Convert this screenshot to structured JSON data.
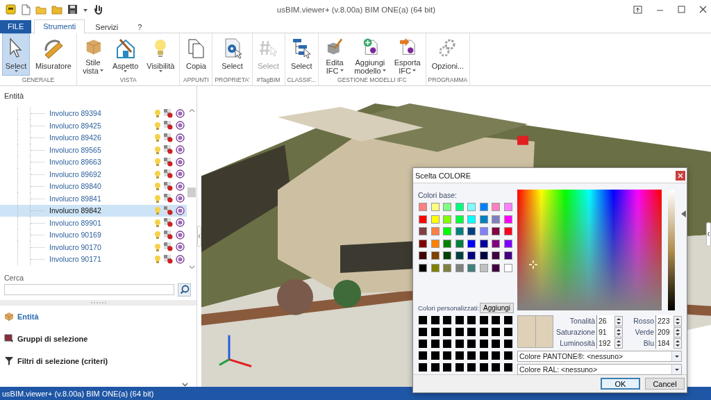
{
  "window": {
    "title": "usBIM.viewer+ (v.8.00a)  BIM ONE(a) (64 bit)"
  },
  "ribbon_tabs": [
    {
      "label": "FILE",
      "kind": "file",
      "selected": false
    },
    {
      "label": "Strumenti",
      "kind": "tab",
      "selected": true
    },
    {
      "label": "Servizi",
      "kind": "tab",
      "selected": false
    },
    {
      "label": "?",
      "kind": "tab",
      "selected": false
    }
  ],
  "ribbon_groups": [
    {
      "label": "GENERALE",
      "buttons": [
        {
          "lines": [
            "Select"
          ],
          "dropdown": true,
          "selected": true,
          "disabled": false
        },
        {
          "lines": [
            "Misuratore"
          ],
          "dropdown": false,
          "selected": false,
          "disabled": false
        }
      ]
    },
    {
      "label": "VISTA",
      "buttons": [
        {
          "lines": [
            "Stile",
            "vista"
          ],
          "dropdown": true,
          "selected": false,
          "disabled": false
        },
        {
          "lines": [
            "Aspetto"
          ],
          "dropdown": true,
          "selected": false,
          "disabled": false
        },
        {
          "lines": [
            "Visibilità"
          ],
          "dropdown": true,
          "selected": false,
          "disabled": false
        }
      ]
    },
    {
      "label": "APPUNTI",
      "buttons": [
        {
          "lines": [
            "Copia"
          ],
          "dropdown": false,
          "selected": false,
          "disabled": false
        }
      ]
    },
    {
      "label": "PROPRIETA'",
      "buttons": [
        {
          "lines": [
            "Select"
          ],
          "dropdown": false,
          "selected": false,
          "disabled": false
        }
      ]
    },
    {
      "label": "#TagBIM",
      "buttons": [
        {
          "lines": [
            "Select"
          ],
          "dropdown": false,
          "selected": false,
          "disabled": true
        }
      ]
    },
    {
      "label": "CLASSIF...",
      "buttons": [
        {
          "lines": [
            "Select"
          ],
          "dropdown": false,
          "selected": false,
          "disabled": false
        }
      ]
    },
    {
      "label": "GESTIONE MODELLI IFC",
      "buttons": [
        {
          "lines": [
            "Edita",
            "IFC"
          ],
          "dropdown": true,
          "selected": false,
          "disabled": false
        },
        {
          "lines": [
            "Aggiungi",
            "modello"
          ],
          "dropdown": true,
          "selected": false,
          "disabled": false
        },
        {
          "lines": [
            "Esporta",
            "IFC"
          ],
          "dropdown": true,
          "selected": false,
          "disabled": false
        }
      ]
    },
    {
      "label": "PROGRAMMA",
      "buttons": [
        {
          "lines": [
            "Opzioni..."
          ],
          "dropdown": false,
          "selected": false,
          "disabled": false
        }
      ]
    }
  ],
  "entities": {
    "header": "Entità",
    "items": [
      {
        "label": "Involucro 89394",
        "selected": false
      },
      {
        "label": "Involucro 89425",
        "selected": false
      },
      {
        "label": "Involucro 89426",
        "selected": false
      },
      {
        "label": "Involucro 89565",
        "selected": false
      },
      {
        "label": "Involucro 89663",
        "selected": false
      },
      {
        "label": "Involucro 89692",
        "selected": false
      },
      {
        "label": "Involucro 89840",
        "selected": false
      },
      {
        "label": "Involucro 89841",
        "selected": false
      },
      {
        "label": "Involucro 89842",
        "selected": true
      },
      {
        "label": "Involucro 89901",
        "selected": false
      },
      {
        "label": "Involucro 90169",
        "selected": false
      },
      {
        "label": "Involucro 90170",
        "selected": false
      },
      {
        "label": "Involucro 90171",
        "selected": false
      }
    ]
  },
  "search_label": "Cerca",
  "nav": [
    {
      "label": "Entità",
      "kind": "entities",
      "selected": true
    },
    {
      "label": "Gruppi di selezione",
      "kind": "groups",
      "selected": false
    },
    {
      "label": "Filtri di selezione (criteri)",
      "kind": "filters",
      "selected": false
    }
  ],
  "color_dialog": {
    "title": "Scelta COLORE",
    "basic_label": "Colori base:",
    "basic_colors": [
      {
        "color": "#ff8080"
      },
      {
        "color": "#ffff80"
      },
      {
        "color": "#80ff80"
      },
      {
        "color": "#00ff80"
      },
      {
        "color": "#80ffff"
      },
      {
        "color": "#0080ff"
      },
      {
        "color": "#ff80c0"
      },
      {
        "color": "#ff80ff"
      },
      {
        "color": "#ff0000"
      },
      {
        "color": "#ffff00"
      },
      {
        "color": "#80ff00"
      },
      {
        "color": "#00ff40"
      },
      {
        "color": "#00ffff"
      },
      {
        "color": "#0080c0"
      },
      {
        "color": "#8080c0"
      },
      {
        "color": "#ff00ff"
      },
      {
        "color": "#804040"
      },
      {
        "color": "#ff8040"
      },
      {
        "color": "#00ff00"
      },
      {
        "color": "#008080"
      },
      {
        "color": "#004080"
      },
      {
        "color": "#8080ff"
      },
      {
        "color": "#800040"
      },
      {
        "color": "#ff0020"
      },
      {
        "color": "#800000"
      },
      {
        "color": "#ff8000"
      },
      {
        "color": "#008000"
      },
      {
        "color": "#008040"
      },
      {
        "color": "#0000ff"
      },
      {
        "color": "#0000a0"
      },
      {
        "color": "#800080"
      },
      {
        "color": "#8000ff"
      },
      {
        "color": "#400000"
      },
      {
        "color": "#804000"
      },
      {
        "color": "#004000"
      },
      {
        "color": "#004040"
      },
      {
        "color": "#000080"
      },
      {
        "color": "#000040"
      },
      {
        "color": "#400040"
      },
      {
        "color": "#400080"
      },
      {
        "color": "#000000"
      },
      {
        "color": "#808000"
      },
      {
        "color": "#808040"
      },
      {
        "color": "#808080"
      },
      {
        "color": "#408080"
      },
      {
        "color": "#c0c0c0"
      },
      {
        "color": "#400040"
      },
      {
        "color": "#ffffff"
      }
    ],
    "custom_label": "Colori personalizzati:",
    "add_button": "Aggiungi",
    "custom_colors": [
      {
        "color": "#000000"
      },
      {
        "color": "#000000"
      },
      {
        "color": "#000000"
      },
      {
        "color": "#000000"
      },
      {
        "color": "#000000"
      },
      {
        "color": "#000000"
      },
      {
        "color": "#000000"
      },
      {
        "color": "#000000"
      },
      {
        "color": "#000000"
      },
      {
        "color": "#000000"
      },
      {
        "color": "#000000"
      },
      {
        "color": "#000000"
      },
      {
        "color": "#000000"
      },
      {
        "color": "#000000"
      },
      {
        "color": "#000000"
      },
      {
        "color": "#000000"
      },
      {
        "color": "#000000"
      },
      {
        "color": "#000000"
      },
      {
        "color": "#000000"
      },
      {
        "color": "#000000"
      },
      {
        "color": "#000000"
      },
      {
        "color": "#000000"
      },
      {
        "color": "#000000"
      },
      {
        "color": "#000000"
      },
      {
        "color": "#000000"
      },
      {
        "color": "#000000"
      },
      {
        "color": "#000000"
      },
      {
        "color": "#000000"
      },
      {
        "color": "#000000"
      },
      {
        "color": "#000000"
      },
      {
        "color": "#000000"
      },
      {
        "color": "#000000"
      },
      {
        "color": "#000000"
      },
      {
        "color": "#000000"
      },
      {
        "color": "#000000"
      },
      {
        "color": "#000000"
      },
      {
        "color": "#000000"
      },
      {
        "color": "#000000"
      },
      {
        "color": "#000000"
      },
      {
        "color": "#000000"
      }
    ],
    "hsl_fields": [
      {
        "label": "Tonalità",
        "value": "26"
      },
      {
        "label": "Saturazione",
        "value": "91"
      },
      {
        "label": "Luminosità",
        "value": "192"
      }
    ],
    "rgb_fields": [
      {
        "label": "Rosso",
        "value": "223"
      },
      {
        "label": "Verde",
        "value": "209"
      },
      {
        "label": "Blu",
        "value": "184"
      }
    ],
    "pantone": "Colore PANTONE®: <nessuno>",
    "ral": "Colore RAL: <nessuno>",
    "buttons": [
      {
        "label": "OK",
        "default": true
      },
      {
        "label": "Cancel",
        "default": false
      }
    ]
  },
  "status_bar": {
    "text": "usBIM.viewer+ (v.8.00a)  BIM ONE(a) (64 bit)"
  }
}
